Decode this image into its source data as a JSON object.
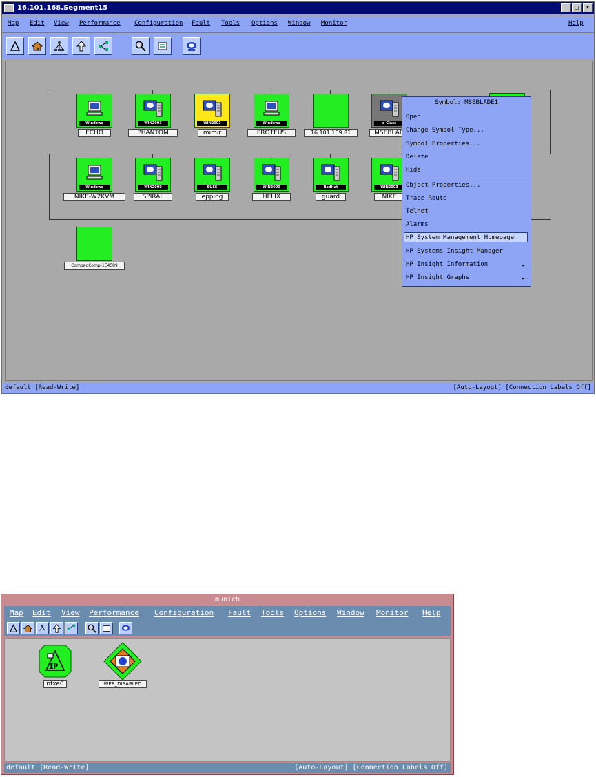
{
  "window1": {
    "title": "16.101.168.Segment15",
    "menu": [
      "Map",
      "Edit",
      "View",
      "Performance",
      "Configuration",
      "Fault",
      "Tools",
      "Options",
      "Window",
      "Monitor"
    ],
    "help": "Help",
    "nodes_row1": [
      {
        "label": "ECHO",
        "tag": "Windows",
        "color": "green"
      },
      {
        "label": "PHANTOM",
        "tag": "WIN2003",
        "color": "green"
      },
      {
        "label": "mimir",
        "tag": "WIN2003",
        "color": "yellow"
      },
      {
        "label": "PROTEUS",
        "tag": "Windows",
        "color": "green"
      },
      {
        "label": "16.101.169.81",
        "tag": "",
        "color": "green"
      },
      {
        "label": "MSEBLAD",
        "tag": "e-Class",
        "color": "grey"
      }
    ],
    "nodes_row2": [
      {
        "label": "NIKE-W2KVM",
        "tag": "Windows",
        "color": "green"
      },
      {
        "label": "SPIRAL",
        "tag": "WIN2000",
        "color": "green"
      },
      {
        "label": "epping",
        "tag": "SUSE",
        "color": "green"
      },
      {
        "label": "HELIX",
        "tag": "WIN2000",
        "color": "green"
      },
      {
        "label": "guard",
        "tag": "RedHat",
        "color": "green"
      },
      {
        "label": "NIKE",
        "tag": "WIN2003",
        "color": "green"
      }
    ],
    "node_row3": {
      "label": "CompaqComp-1E4589"
    },
    "context_menu": {
      "header": "Symbol: MSEBLADE1",
      "items": [
        "Open",
        "Change Symbol Type...",
        "Symbol Properties...",
        "Delete",
        "Hide",
        "Object Properties...",
        "Trace Route",
        "Telnet",
        "Alarms",
        "HP System Management Homepage",
        "HP Systems Insight Manager",
        "HP Insight Information",
        "HP Insight Graphs"
      ],
      "highlighted": "HP System Management Homepage"
    },
    "status_left": "default [Read-Write]",
    "status_right": "[Auto-Layout] [Connection Labels Off]"
  },
  "window2": {
    "title": "munich",
    "menu": [
      "Map",
      "Edit",
      "View",
      "Performance",
      "Configuration",
      "Fault",
      "Tools",
      "Options",
      "Window",
      "Monitor",
      "Help"
    ],
    "nodes": [
      {
        "label": "nfxe0",
        "tag": "IP"
      },
      {
        "label": "WEB_DISABLED"
      }
    ],
    "status_left": "default [Read-Write]",
    "status_right": "[Auto-Layout] [Connection Labels Off]"
  },
  "colors": {
    "node_green": "#22ee22",
    "node_yellow": "#ffe81a",
    "menu_blue": "#8ea4f5",
    "title_blue": "#000c73"
  }
}
